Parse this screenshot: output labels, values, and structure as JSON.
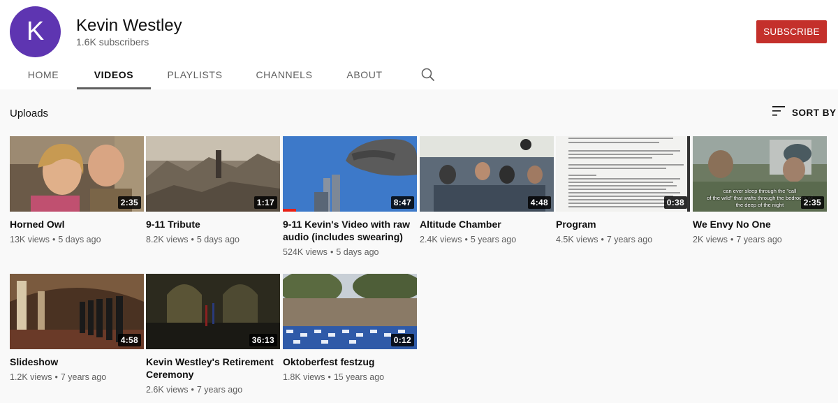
{
  "channel": {
    "avatar_letter": "K",
    "avatar_color": "#5e35b1",
    "name": "Kevin Westley",
    "subscribers": "1.6K subscribers",
    "subscribe_label": "SUBSCRIBE",
    "subscribe_color": "#c4302b"
  },
  "tabs": [
    {
      "label": "HOME"
    },
    {
      "label": "VIDEOS",
      "active": true
    },
    {
      "label": "PLAYLISTS"
    },
    {
      "label": "CHANNELS"
    },
    {
      "label": "ABOUT"
    }
  ],
  "search_icon": "search-icon",
  "section": {
    "title": "Uploads",
    "sort_label": "SORT BY",
    "sort_icon": "sort-icon"
  },
  "videos": [
    {
      "title": "Horned Owl",
      "duration": "2:35",
      "views": "13K views",
      "age": "5 days ago"
    },
    {
      "title": "9-11 Tribute",
      "duration": "1:17",
      "views": "8.2K views",
      "age": "5 days ago"
    },
    {
      "title": "9-11 Kevin's Video with raw audio (includes swearing)",
      "duration": "8:47",
      "views": "524K views",
      "age": "5 days ago",
      "watched_fraction": 0.1
    },
    {
      "title": "Altitude Chamber",
      "duration": "4:48",
      "views": "2.4K views",
      "age": "5 years ago"
    },
    {
      "title": "Program",
      "duration": "0:38",
      "views": "4.5K views",
      "age": "7 years ago"
    },
    {
      "title": "We Envy No One",
      "duration": "2:35",
      "views": "2K views",
      "age": "7 years ago",
      "thumb_caption": [
        "can ever sleep through the \"call",
        "of the wild\" that wafts through the bedroom wi",
        "the deep of the night"
      ]
    },
    {
      "title": "Slideshow",
      "duration": "4:58",
      "views": "1.2K views",
      "age": "7 years ago"
    },
    {
      "title": "Kevin Westley's Retirement Ceremony",
      "duration": "36:13",
      "views": "2.6K views",
      "age": "7 years ago"
    },
    {
      "title": "Oktoberfest festzug",
      "duration": "0:12",
      "views": "1.8K views",
      "age": "15 years ago"
    }
  ]
}
